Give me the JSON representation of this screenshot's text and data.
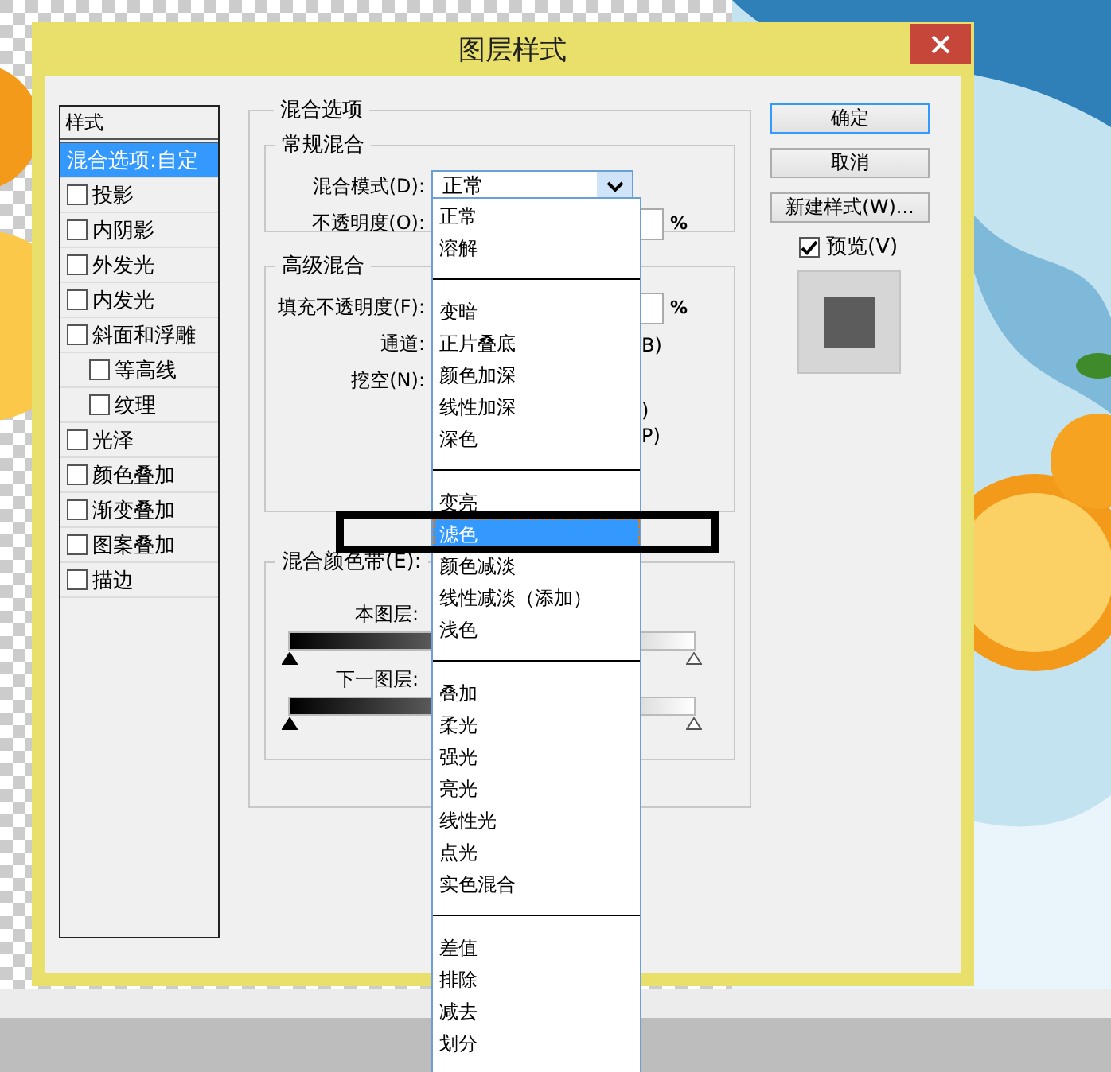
{
  "window": {
    "title": "图层样式"
  },
  "styles": {
    "header": "样式",
    "items": [
      {
        "kind": "option",
        "label": "混合选项:自定",
        "selected": true
      },
      {
        "kind": "effect",
        "label": "投影",
        "selected": false,
        "checked": false
      },
      {
        "kind": "effect",
        "label": "内阴影",
        "selected": false,
        "checked": false
      },
      {
        "kind": "effect",
        "label": "外发光",
        "selected": false,
        "checked": false
      },
      {
        "kind": "effect",
        "label": "内发光",
        "selected": false,
        "checked": false
      },
      {
        "kind": "effect",
        "label": "斜面和浮雕",
        "selected": false,
        "checked": false,
        "children": [
          {
            "kind": "effect",
            "label": "等高线",
            "selected": false,
            "checked": false
          },
          {
            "kind": "effect",
            "label": "纹理",
            "selected": false,
            "checked": false
          }
        ]
      },
      {
        "kind": "effect",
        "label": "光泽",
        "selected": false,
        "checked": false
      },
      {
        "kind": "effect",
        "label": "颜色叠加",
        "selected": false,
        "checked": false
      },
      {
        "kind": "effect",
        "label": "渐变叠加",
        "selected": false,
        "checked": false
      },
      {
        "kind": "effect",
        "label": "图案叠加",
        "selected": false,
        "checked": false
      },
      {
        "kind": "effect",
        "label": "描边",
        "selected": false,
        "checked": false
      }
    ]
  },
  "blend_options": {
    "title": "混合选项",
    "general": {
      "title": "常规混合",
      "mode_label": "混合模式(D):",
      "mode_value": "正常",
      "opacity_label": "不透明度(O):",
      "opacity_unit": "%"
    },
    "advanced": {
      "title": "高级混合",
      "fill_label": "填充不透明度(F):",
      "fill_unit": "%",
      "channels_label": "通道:",
      "channels_tail": "B)",
      "knockout_label": "挖空(N):",
      "fragments": [
        ")",
        "P)"
      ]
    },
    "blend_if": {
      "title": "混合颜色带(E):",
      "sliders": [
        {
          "label": "本图层:",
          "thumbs": [
            {
              "level": 0
            },
            {
              "level": 1
            }
          ]
        },
        {
          "label": "下一图层:",
          "thumbs": [
            {
              "level": 0
            },
            {
              "level": 1
            }
          ]
        }
      ]
    }
  },
  "buttons": [
    {
      "label": "确定",
      "focused": true
    },
    {
      "label": "取消",
      "focused": false
    },
    {
      "label": "新建样式(W)...",
      "focused": false
    }
  ],
  "preview": {
    "label": "预览(V)",
    "checked": true
  },
  "dropdown": {
    "items": [
      {
        "kind": "item",
        "label": "正常",
        "selected": false
      },
      {
        "kind": "item",
        "label": "溶解",
        "selected": false
      },
      {
        "kind": "separator"
      },
      {
        "kind": "item",
        "label": "变暗",
        "selected": false
      },
      {
        "kind": "item",
        "label": "正片叠底",
        "selected": false
      },
      {
        "kind": "item",
        "label": "颜色加深",
        "selected": false
      },
      {
        "kind": "item",
        "label": "线性加深",
        "selected": false
      },
      {
        "kind": "item",
        "label": "深色",
        "selected": false
      },
      {
        "kind": "separator"
      },
      {
        "kind": "item",
        "label": "变亮",
        "selected": false
      },
      {
        "kind": "item",
        "label": "滤色",
        "selected": true
      },
      {
        "kind": "item",
        "label": "颜色减淡",
        "selected": false
      },
      {
        "kind": "item",
        "label": "线性减淡（添加）",
        "selected": false
      },
      {
        "kind": "item",
        "label": "浅色",
        "selected": false
      },
      {
        "kind": "separator"
      },
      {
        "kind": "item",
        "label": "叠加",
        "selected": false
      },
      {
        "kind": "item",
        "label": "柔光",
        "selected": false
      },
      {
        "kind": "item",
        "label": "强光",
        "selected": false
      },
      {
        "kind": "item",
        "label": "亮光",
        "selected": false
      },
      {
        "kind": "item",
        "label": "线性光",
        "selected": false
      },
      {
        "kind": "item",
        "label": "点光",
        "selected": false
      },
      {
        "kind": "item",
        "label": "实色混合",
        "selected": false
      },
      {
        "kind": "separator"
      },
      {
        "kind": "item",
        "label": "差值",
        "selected": false
      },
      {
        "kind": "item",
        "label": "排除",
        "selected": false
      },
      {
        "kind": "item",
        "label": "减去",
        "selected": false
      },
      {
        "kind": "item",
        "label": "划分",
        "selected": false
      }
    ]
  }
}
